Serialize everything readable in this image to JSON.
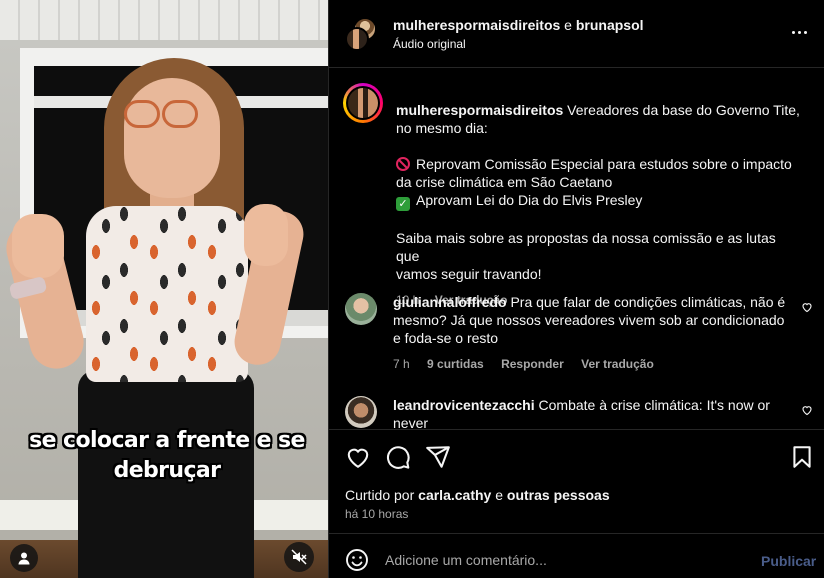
{
  "video": {
    "caption_lines": [
      "se colocar a frente e se",
      "debruçar"
    ],
    "icons": {
      "tag_users": "user-icon",
      "mute": "speaker-muted-icon"
    }
  },
  "header": {
    "user1": "mulherespormaisdireitos",
    "connector": "e",
    "user2": "brunapsol",
    "audio": "Áudio original",
    "more_icon": "more-horizontal-icon"
  },
  "post_caption": {
    "username": "mulherespormaisdireitos",
    "line1": "Vereadores da base do Governo Tite,",
    "line2": "no mesmo dia:",
    "item1_a": "Reprovam Comissão Especial para estudos sobre o impacto",
    "item1_b": "da crise climática em São Caetano",
    "item2": "Aprovam Lei do Dia do Elvis Presley",
    "para2_a": "Saiba mais sobre as propostas da nossa comissão e as lutas que",
    "para2_b": "vamos seguir travando!",
    "time": "10 h",
    "translate": "Ver tradução"
  },
  "comments": [
    {
      "username": "giuliannaloffredo",
      "text": "Pra que falar de condições climáticas, não é mesmo? Já que nossos vereadores vivem sob ar condicionado e foda-se o resto",
      "time": "7 h",
      "likes": "9 curtidas",
      "reply": "Responder",
      "translate": "Ver tradução"
    },
    {
      "username": "leandrovicentezacchi",
      "text": "Combate à crise climática: It's now or never"
    }
  ],
  "actions": {
    "liked_by_prefix": "Curtido por",
    "liked_by_user": "carla.cathy",
    "liked_by_and": "e",
    "liked_by_others": "outras pessoas",
    "posted_ago": "há 10 horas"
  },
  "add_comment": {
    "placeholder": "Adicione um comentário...",
    "post_label": "Publicar"
  },
  "colors": {
    "background": "#000000",
    "text_primary": "#f5f5f5",
    "text_secondary": "#a8a8a8",
    "divider": "#262626",
    "publish_disabled": "#4a5d8a"
  }
}
